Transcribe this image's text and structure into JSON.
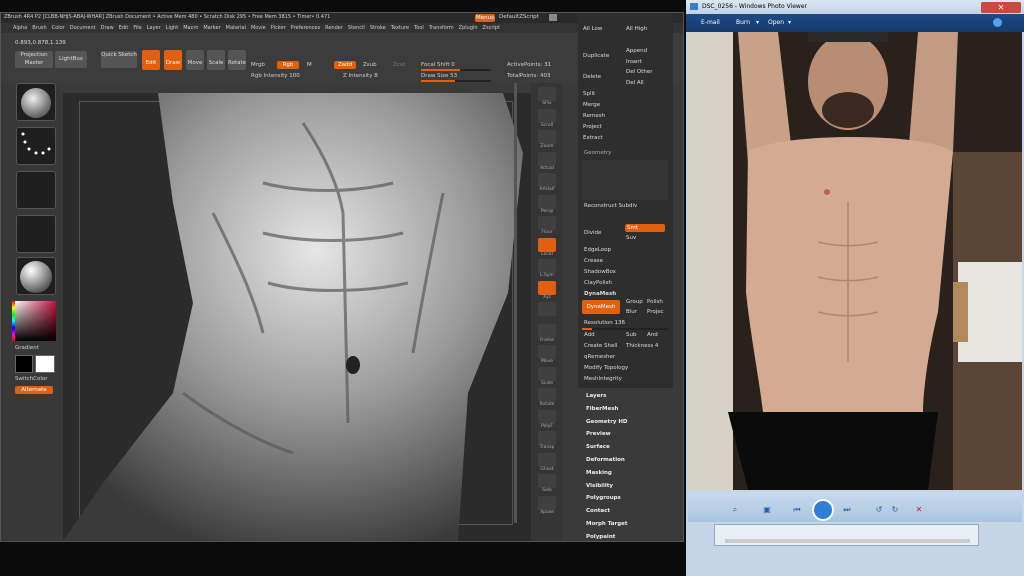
{
  "zbrush": {
    "titlebar": "ZBrush 4R4 P2  [CLBB-NHJS-ABAJ-WHAR]    ZBrush Document    • Active Mem 480 • Scratch Disk 295 • Free Mem 3815 • Timer• 0.471",
    "menus_btn": "Menus",
    "default_script": "DefaultZScript",
    "menubar": [
      "Alpha",
      "Brush",
      "Color",
      "Document",
      "Draw",
      "Edit",
      "File",
      "Layer",
      "Light",
      "Macro",
      "Marker",
      "Material",
      "Movie",
      "Picker",
      "Preferences",
      "Render",
      "Stencil",
      "Stroke",
      "Texture",
      "Tool",
      "Transform",
      "Zplugin",
      "Zscript"
    ],
    "coords": "0.893,0.878,1.139",
    "top": {
      "projection_master": "Projection Master",
      "lightbox": "LightBox",
      "quick_sketch": "Quick Sketch",
      "edit": "Edit",
      "draw": "Draw",
      "move": "Move",
      "scale": "Scale",
      "rotate": "Rotate",
      "mrgb": "Mrgb",
      "rgb": "Rgb",
      "m": "M",
      "zadd": "Zadd",
      "zsub": "Zsub",
      "zcut": "Zcut",
      "rgb_intensity": "Rgb Intensity 100",
      "z_intensity": "Z Intensity 8",
      "focal_shift": "Focal Shift 0",
      "draw_size": "Draw Size 53",
      "active_points": "ActivePoints: 31",
      "total_points": "TotalPoints: 403"
    },
    "left": {
      "gradient": "Gradient",
      "switch_color": "SwitchColor",
      "alternate": "Alternate"
    },
    "shelf": [
      "SPix",
      "Scroll",
      "Zoom",
      "Actual",
      "AAHalf",
      "Persp",
      "Floor",
      "Local",
      "L.Sym",
      "Xyz",
      "",
      "Frame",
      "Move",
      "Scale",
      "Rotate",
      "PolyF",
      "Transp",
      "Ghost",
      "Solo",
      "Xpose"
    ],
    "subtool": {
      "all_low": "All Low",
      "all_high": "All High",
      "duplicate": "Duplicate",
      "append": "Append",
      "insert": "Insert",
      "delete": "Delete",
      "del_other": "Del Other",
      "del_all": "Del All",
      "split": "Split",
      "merge": "Merge",
      "remesh": "Remesh",
      "project": "Project",
      "extract": "Extract",
      "geometry": "Geometry",
      "reconstruct_subdiv": "Reconstruct Subdiv",
      "divide": "Divide",
      "smt": "Smt",
      "suv": "Suv",
      "edgeloop": "EdgeLoop",
      "crease": "Crease",
      "shadowbox": "ShadowBox",
      "claypolish": "ClayPolish",
      "dynamesh_header": "DynaMesh",
      "dynamesh": "DynaMesh",
      "group": "Group",
      "polish": "Polish",
      "blur": "Blur",
      "project2": "Projec",
      "resolution": "Resolution 136",
      "add": "Add",
      "sub": "Sub",
      "and": "And",
      "create_shell": "Create Shell",
      "thickness": "Thickness 4",
      "qremesher": "qRemesher",
      "modify_topology": "Modify Topology",
      "meshintegrity": "MeshIntegrity"
    },
    "menus": [
      "Layers",
      "FiberMesh",
      "Geometry HD",
      "Preview",
      "Surface",
      "Deformation",
      "Masking",
      "Visibility",
      "Polygroups",
      "Contact",
      "Morph Target",
      "Polypaint"
    ]
  },
  "photoviewer": {
    "title": "DSC_0256 - Windows Photo Viewer",
    "email": "E-mail",
    "burn": "Burn",
    "open": "Open"
  },
  "colors": {
    "accent": "#e06010",
    "panel": "#3a3a3a",
    "viewer_frame": "#c6d6e8"
  }
}
